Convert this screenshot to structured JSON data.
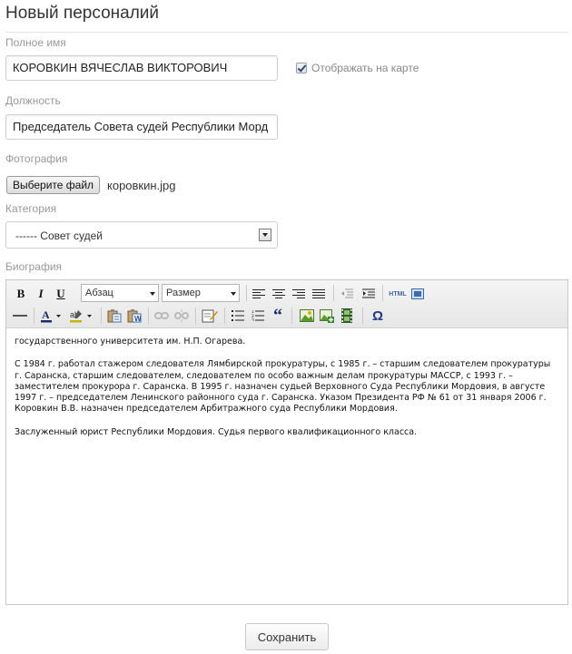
{
  "page": {
    "title": "Новый персоналий"
  },
  "fields": {
    "full_name": {
      "label": "Полное имя",
      "value": "КОРОВКИН ВЯЧЕСЛАВ ВИКТОРОВИЧ"
    },
    "show_on_map": {
      "label": "Отображать на карте",
      "checked": true
    },
    "position": {
      "label": "Должность",
      "value": "Председатель Совета судей Республики Морд"
    },
    "photo": {
      "label": "Фотография",
      "button_label": "Выберите файл",
      "file_name": "коровкин.jpg"
    },
    "category": {
      "label": "Категория",
      "selected": "------ Совет судей"
    },
    "biography": {
      "label": "Биография",
      "toolbar": {
        "format_label": "Абзац",
        "size_label": "Размер",
        "html_label": "HTML",
        "omega_label": "Ω",
        "quote_label": "“"
      },
      "paragraphs": [
        "государственного университета им. Н.П. Огарева.",
        "С 1984 г. работал стажером следователя Лямбирской прокуратуры, с 1985 г. – старшим следователем прокуратуры г. Саранска, старшим следователем, следователем по особо важным делам прокуратуры МАССР, с 1993 г. – заместителем прокурора г. Саранска.  В 1995 г. назначен судьей Верховного Суда Республики Мордовия, в августе 1997 г. – председателем Ленинского районного суда г. Саранска. Указом Президента РФ № 61 от 31 января 2006 г. Коровкин В.В. назначен председателем Арбитражного суда Республики Мордовия.",
        "Заслуженный юрист Республики Мордовия. Судья первого квалификационного класса."
      ]
    }
  },
  "actions": {
    "save_label": "Сохранить"
  },
  "icons": {
    "bold": "B",
    "italic": "I",
    "underline": "U",
    "align": [
      "align-left-icon",
      "align-center-icon",
      "align-right-icon",
      "align-justify-icon"
    ]
  }
}
